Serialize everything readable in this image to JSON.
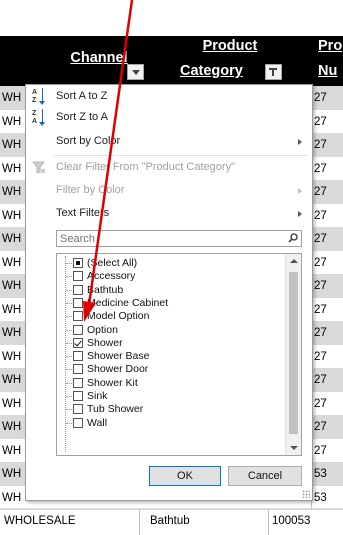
{
  "header": {
    "channel": "Channel",
    "product_category_line1": "Product",
    "product_category_line2": "Category",
    "product_number_line1": "Pro",
    "product_number_line2": "Nu"
  },
  "rows": [
    {
      "channel": "WH",
      "number": "27"
    },
    {
      "channel": "WH",
      "number": "27"
    },
    {
      "channel": "WH",
      "number": "27"
    },
    {
      "channel": "WH",
      "number": "27"
    },
    {
      "channel": "WH",
      "number": "27"
    },
    {
      "channel": "WH",
      "number": "27"
    },
    {
      "channel": "WH",
      "number": "27"
    },
    {
      "channel": "WH",
      "number": "27"
    },
    {
      "channel": "WH",
      "number": "27"
    },
    {
      "channel": "WH",
      "number": "27"
    },
    {
      "channel": "WH",
      "number": "27"
    },
    {
      "channel": "WH",
      "number": "27"
    },
    {
      "channel": "WH",
      "number": "27"
    },
    {
      "channel": "WH",
      "number": "27"
    },
    {
      "channel": "WH",
      "number": "27"
    },
    {
      "channel": "WH",
      "number": "27"
    },
    {
      "channel": "WH",
      "number": "53"
    },
    {
      "channel": "WH",
      "number": "53"
    }
  ],
  "last_row": {
    "channel": "WHOLESALE",
    "category": "Bathtub",
    "number": "100053"
  },
  "menu": {
    "sort_az": "Sort A to Z",
    "sort_za": "Sort Z to A",
    "sort_by_color": "Sort by Color",
    "clear_filter": "Clear Filter From \"Product Category\"",
    "filter_by_color": "Filter by Color",
    "text_filters": "Text Filters",
    "search_placeholder": "Search"
  },
  "filter_items": [
    {
      "label": "(Select All)",
      "state": "partial"
    },
    {
      "label": "Accessory",
      "state": "unchecked"
    },
    {
      "label": "Bathtub",
      "state": "unchecked"
    },
    {
      "label": "Medicine Cabinet",
      "state": "unchecked"
    },
    {
      "label": "Model Option",
      "state": "unchecked"
    },
    {
      "label": "Option",
      "state": "unchecked"
    },
    {
      "label": "Shower",
      "state": "checked"
    },
    {
      "label": "Shower Base",
      "state": "unchecked"
    },
    {
      "label": "Shower Door",
      "state": "unchecked"
    },
    {
      "label": "Shower Kit",
      "state": "unchecked"
    },
    {
      "label": "Sink",
      "state": "unchecked"
    },
    {
      "label": "Tub Shower",
      "state": "unchecked"
    },
    {
      "label": "Wall",
      "state": "unchecked"
    }
  ],
  "buttons": {
    "ok": "OK",
    "cancel": "Cancel"
  },
  "colors": {
    "header_bg": "#000000",
    "annotation_arrow": "#e00000",
    "ok_border": "#0078d7"
  },
  "icons": {
    "sort_az": "sort-ascending-icon",
    "sort_za": "sort-descending-icon",
    "clear_filter": "clear-filter-icon",
    "search": "search-icon",
    "dropdown": "filter-dropdown-icon"
  }
}
